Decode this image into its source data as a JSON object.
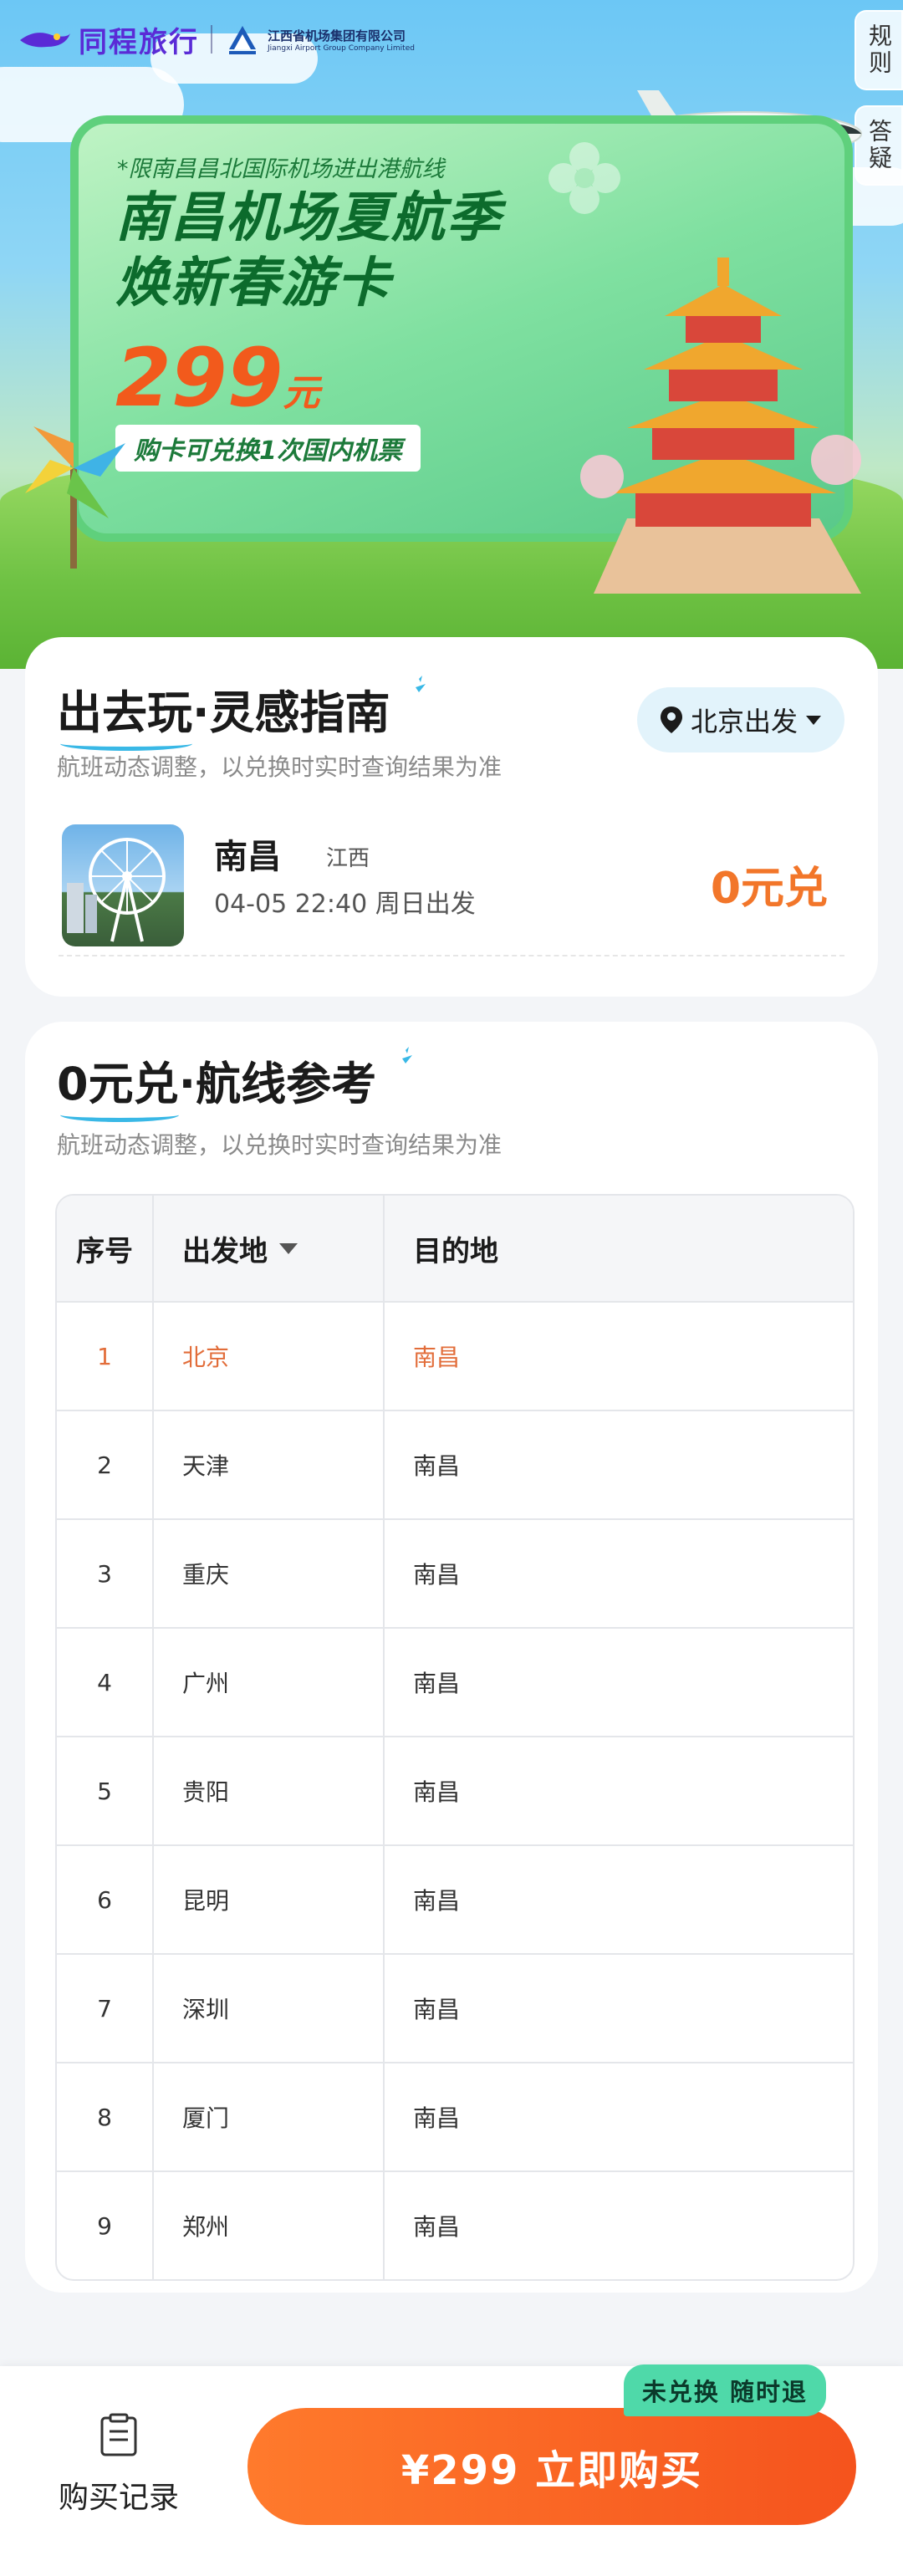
{
  "header": {
    "brand_name": "同程旅行",
    "partner_name_cn": "江西省机场集团有限公司",
    "partner_name_en": "Jiangxi Airport Group Company Limited",
    "side_tabs": [
      "规则",
      "答疑"
    ]
  },
  "banner": {
    "note": "*限南昌昌北国际机场进出港航线",
    "title_line1": "南昌机场夏航季",
    "title_line2": "焕新春游卡",
    "price_value": "299",
    "price_unit": "元",
    "description": "购卡可兑换1次国内机票"
  },
  "guide": {
    "title_highlight": "出去玩",
    "title_rest": "·灵感指南",
    "subtitle": "航班动态调整，以兑换时实时查询结果为准",
    "depart_button": "北京出发",
    "route": {
      "city": "南昌",
      "province": "江西",
      "time": "04-05 22:40 周日出发",
      "price": "0元兑"
    }
  },
  "routes": {
    "title_highlight": "0元兑",
    "title_rest": "·航线参考",
    "subtitle": "航班动态调整，以兑换时实时查询结果为准",
    "columns": [
      "序号",
      "出发地",
      "目的地"
    ],
    "rows": [
      {
        "index": "1",
        "from": "北京",
        "to": "南昌"
      },
      {
        "index": "2",
        "from": "天津",
        "to": "南昌"
      },
      {
        "index": "3",
        "from": "重庆",
        "to": "南昌"
      },
      {
        "index": "4",
        "from": "广州",
        "to": "南昌"
      },
      {
        "index": "5",
        "from": "贵阳",
        "to": "南昌"
      },
      {
        "index": "6",
        "from": "昆明",
        "to": "南昌"
      },
      {
        "index": "7",
        "from": "深圳",
        "to": "南昌"
      },
      {
        "index": "8",
        "from": "厦门",
        "to": "南昌"
      },
      {
        "index": "9",
        "from": "郑州",
        "to": "南昌"
      }
    ]
  },
  "footer": {
    "history_label": "购买记录",
    "buy_label": "¥299 立即购买",
    "buy_badge": "未兑换 随时退"
  },
  "colors": {
    "accent_orange": "#f5531d",
    "price_orange": "#f2762a",
    "badge_green": "#4fd9a9",
    "brand_purple": "#5a2bd6",
    "highlight_blue": "#39b8e6"
  }
}
